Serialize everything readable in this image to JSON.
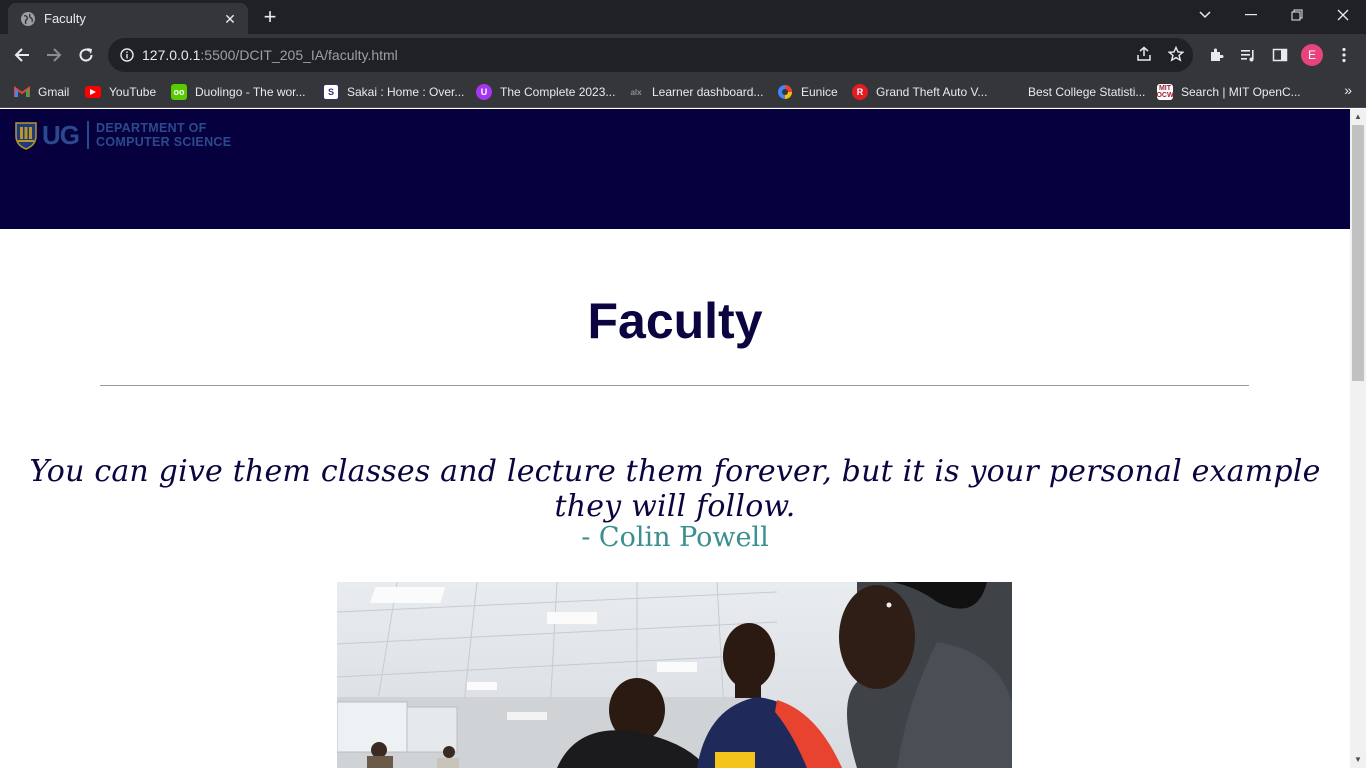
{
  "browser": {
    "tab": {
      "title": "Faculty",
      "favicon": "globe-icon"
    },
    "url": {
      "host": "127.0.0.1",
      "rest": ":5500/DCIT_205_IA/faculty.html"
    },
    "profile_initial": "E",
    "bookmarks": [
      {
        "label": "Gmail",
        "icon": "gmail-icon",
        "color": "#ea4335"
      },
      {
        "label": "YouTube",
        "icon": "youtube-icon",
        "color": "#ff0000"
      },
      {
        "label": "Duolingo - The wor...",
        "icon": "duolingo-icon",
        "color": "#58cc02"
      },
      {
        "label": "Sakai : Home : Over...",
        "icon": "sakai-icon",
        "color": "#ffffff"
      },
      {
        "label": "The Complete 2023...",
        "icon": "udemy-icon",
        "color": "#a435f0"
      },
      {
        "label": "Learner dashboard...",
        "icon": "alx-icon",
        "color": "#35363a"
      },
      {
        "label": "Eunice",
        "icon": "circle-logo-icon",
        "color": "#4285f4"
      },
      {
        "label": "Grand Theft Auto V...",
        "icon": "gta-icon",
        "color": "#e31b23"
      },
      {
        "label": "Best College Statisti...",
        "icon": "blank-icon",
        "color": "#35363a"
      },
      {
        "label": "Search | MIT OpenC...",
        "icon": "mit-ocw-icon",
        "color": "#ffffff"
      }
    ],
    "overflow": "»"
  },
  "site": {
    "logo": {
      "ug": "UG",
      "dept_line1": "DEPARTMENT OF",
      "dept_line2": "COMPUTER SCIENCE"
    },
    "header_color": "#07003f",
    "title": "Faculty",
    "quote": "You can give them classes and lecture them forever, but it is your personal example they will follow.",
    "author": "- Colin Powell"
  }
}
